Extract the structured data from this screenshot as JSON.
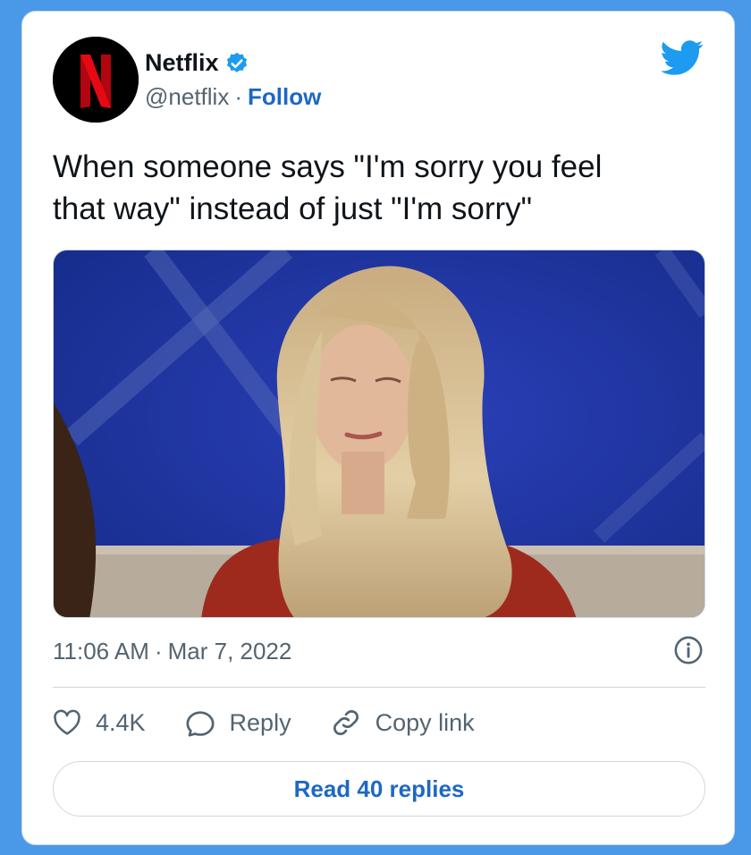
{
  "tweet": {
    "author_name": "Netflix",
    "handle": "@netflix",
    "separator": "·",
    "follow_label": "Follow",
    "text_line1": "When someone says \"I'm sorry you feel",
    "text_line2": "that way\" instead of just \"I'm sorry\"",
    "time": "11:06 AM",
    "date": "Mar 7, 2022",
    "likes": "4.4K",
    "reply_label": "Reply",
    "copy_link_label": "Copy link",
    "read_replies_label": "Read 40 replies"
  },
  "icons": {
    "avatar": "netflix-n-logo",
    "verified": "verified-badge-icon",
    "brand": "twitter-bird-icon",
    "info": "info-icon",
    "like": "heart-icon",
    "reply": "speech-bubble-icon",
    "copy": "link-icon"
  },
  "colors": {
    "background": "#4a99e9",
    "card": "#ffffff",
    "link": "#1d68c4",
    "secondary_text": "#536471",
    "netflix_red": "#e50914",
    "twitter_blue": "#1d9bf0"
  }
}
